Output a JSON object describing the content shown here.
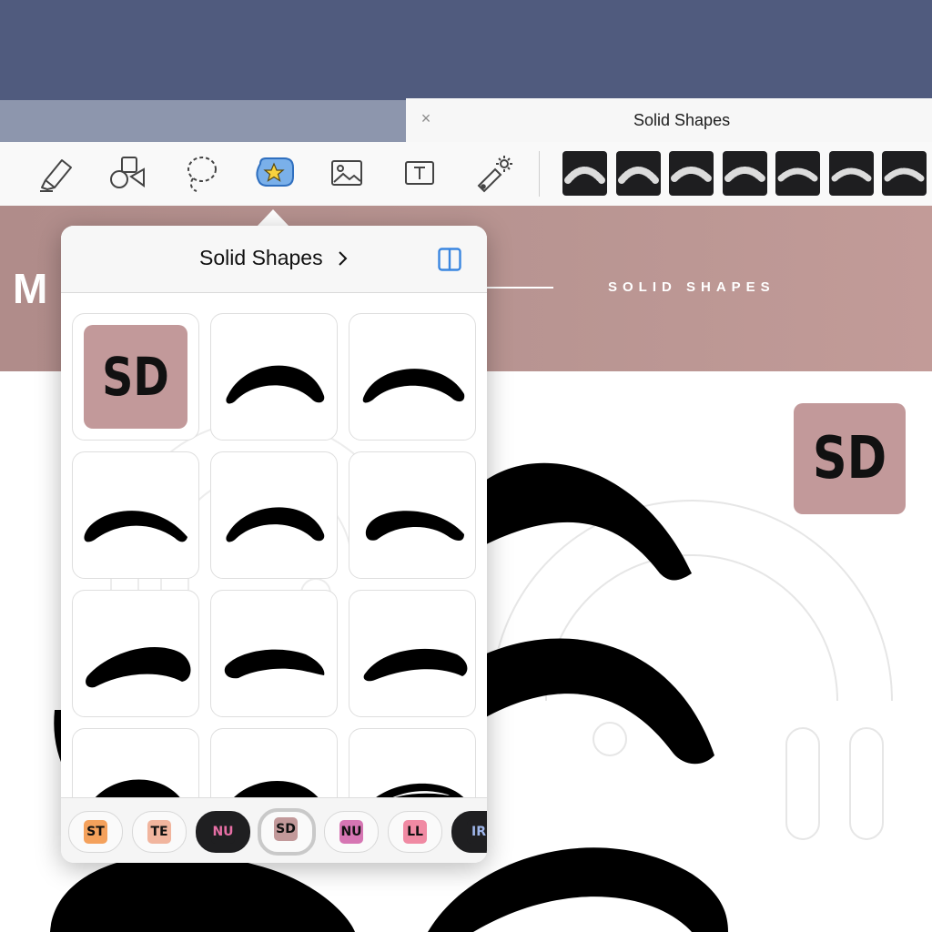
{
  "tab": {
    "close_glyph": "×",
    "title": "Solid Shapes"
  },
  "toolbar": {
    "tools": [
      "highlighter-icon",
      "shapes-icon",
      "lasso-icon",
      "elements-sticker-icon",
      "image-icon",
      "text-box-icon",
      "laser-pointer-icon"
    ],
    "active_tool": "elements-sticker-icon",
    "accent": "#4a8fe0"
  },
  "banner": {
    "letter": "M",
    "title": "SOLID SHAPES",
    "color": "#b99592"
  },
  "badge": {
    "text": "SD",
    "color": "#c2999a"
  },
  "popover": {
    "title": "Solid Shapes",
    "chevron": "›",
    "grid_first_cell": "SD"
  },
  "chips": [
    {
      "label": "ST",
      "color": "#f4a15c",
      "dark": false
    },
    {
      "label": "TE",
      "color": "#f1b59e",
      "dark": false
    },
    {
      "label": "NU",
      "color": "#1f1f21",
      "text_color": "#e66fa5",
      "dark": true
    },
    {
      "label": "SD",
      "color": "#c2999a",
      "dark": false,
      "selected": true
    },
    {
      "label": "NU",
      "color": "#d676b3",
      "dark": false
    },
    {
      "label": "LL",
      "color": "#f08aa3",
      "dark": false
    },
    {
      "label": "IR",
      "color": "#1f1f21",
      "text_color": "#9fb6ea",
      "dark": true
    }
  ]
}
